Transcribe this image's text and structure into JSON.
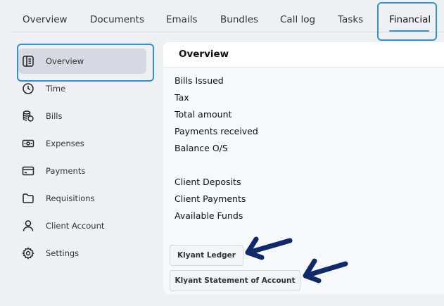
{
  "tabs": [
    {
      "label": "Overview"
    },
    {
      "label": "Documents"
    },
    {
      "label": "Emails"
    },
    {
      "label": "Bundles"
    },
    {
      "label": "Call log"
    },
    {
      "label": "Tasks"
    },
    {
      "label": "Financial",
      "active": true
    }
  ],
  "sidebar": {
    "items": [
      {
        "label": "Overview",
        "icon": "overview-icon",
        "active": true
      },
      {
        "label": "Time",
        "icon": "clock-icon"
      },
      {
        "label": "Bills",
        "icon": "coins-icon"
      },
      {
        "label": "Expenses",
        "icon": "banknote-icon"
      },
      {
        "label": "Payments",
        "icon": "credit-card-icon"
      },
      {
        "label": "Requisitions",
        "icon": "folder-icon"
      },
      {
        "label": "Client Account",
        "icon": "user-icon"
      },
      {
        "label": "Settings",
        "icon": "gear-icon"
      }
    ]
  },
  "main": {
    "title": "Overview",
    "summary_rows": [
      "Bills Issued",
      "Tax",
      "Total amount",
      "Payments received",
      "Balance O/S"
    ],
    "funds_rows": [
      "Client Deposits",
      "Client Payments",
      "Available Funds"
    ],
    "buttons": {
      "ledger": "Klyant Ledger",
      "statement": "Klyant Statement of Account"
    }
  },
  "colors": {
    "accent": "#2a93dc",
    "arrow": "#0f2a6b",
    "background": "#eef0f3",
    "active_item_bg": "#d6d9e2"
  }
}
